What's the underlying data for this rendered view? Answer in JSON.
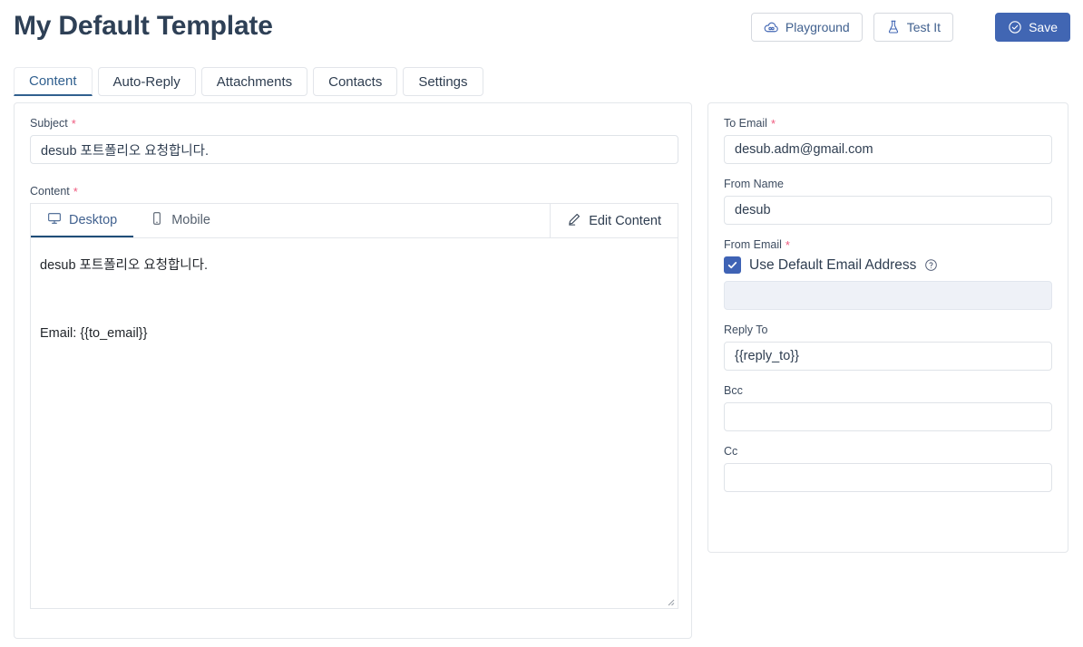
{
  "header": {
    "title": "My Default Template",
    "actions": [
      {
        "label": "Playground",
        "icon": "cloud-infinity-icon",
        "style": "outline"
      },
      {
        "label": "Test It",
        "icon": "flask-icon",
        "style": "outline"
      },
      {
        "label": "Save",
        "icon": "check-circle-icon",
        "style": "primary"
      }
    ]
  },
  "tabs": [
    {
      "label": "Content",
      "active": true
    },
    {
      "label": "Auto-Reply",
      "active": false
    },
    {
      "label": "Attachments",
      "active": false
    },
    {
      "label": "Contacts",
      "active": false
    },
    {
      "label": "Settings",
      "active": false
    }
  ],
  "left_panel": {
    "subject": {
      "label": "Subject",
      "required": true,
      "value": "desub 포트폴리오 요청합니다.",
      "placeholder": ""
    },
    "content": {
      "label": "Content",
      "required": true,
      "view_tabs": [
        {
          "label": "Desktop",
          "icon": "monitor-icon",
          "active": true
        },
        {
          "label": "Mobile",
          "icon": "phone-icon",
          "active": false
        }
      ],
      "edit_button": {
        "label": "Edit Content",
        "icon": "pencil-icon"
      },
      "body_lines": [
        "desub 포트폴리오 요청합니다.",
        "Email: {{to_email}}"
      ]
    }
  },
  "right_panel": {
    "to_email": {
      "label": "To Email",
      "required": true,
      "value": "desub.adm@gmail.com",
      "placeholder": ""
    },
    "from_name": {
      "label": "From Name",
      "required": false,
      "value": "desub",
      "placeholder": ""
    },
    "from_email": {
      "label": "From Email",
      "required": true,
      "checkbox_label": "Use Default Email Address",
      "checkbox_checked": true,
      "help_icon": "question-circle-icon",
      "value": "",
      "placeholder": "",
      "disabled": true
    },
    "reply_to": {
      "label": "Reply To",
      "required": false,
      "value": "{{reply_to}}",
      "placeholder": ""
    },
    "bcc": {
      "label": "Bcc",
      "required": false,
      "value": "",
      "placeholder": ""
    },
    "cc": {
      "label": "Cc",
      "required": false,
      "value": "",
      "placeholder": ""
    }
  },
  "colors": {
    "primary": "#4166b3",
    "accent_blue": "#31608f",
    "required_star": "#ef5b7f",
    "title": "#2e4056",
    "border": "#e4e7eb",
    "disabled_bg": "#eef1f7"
  }
}
